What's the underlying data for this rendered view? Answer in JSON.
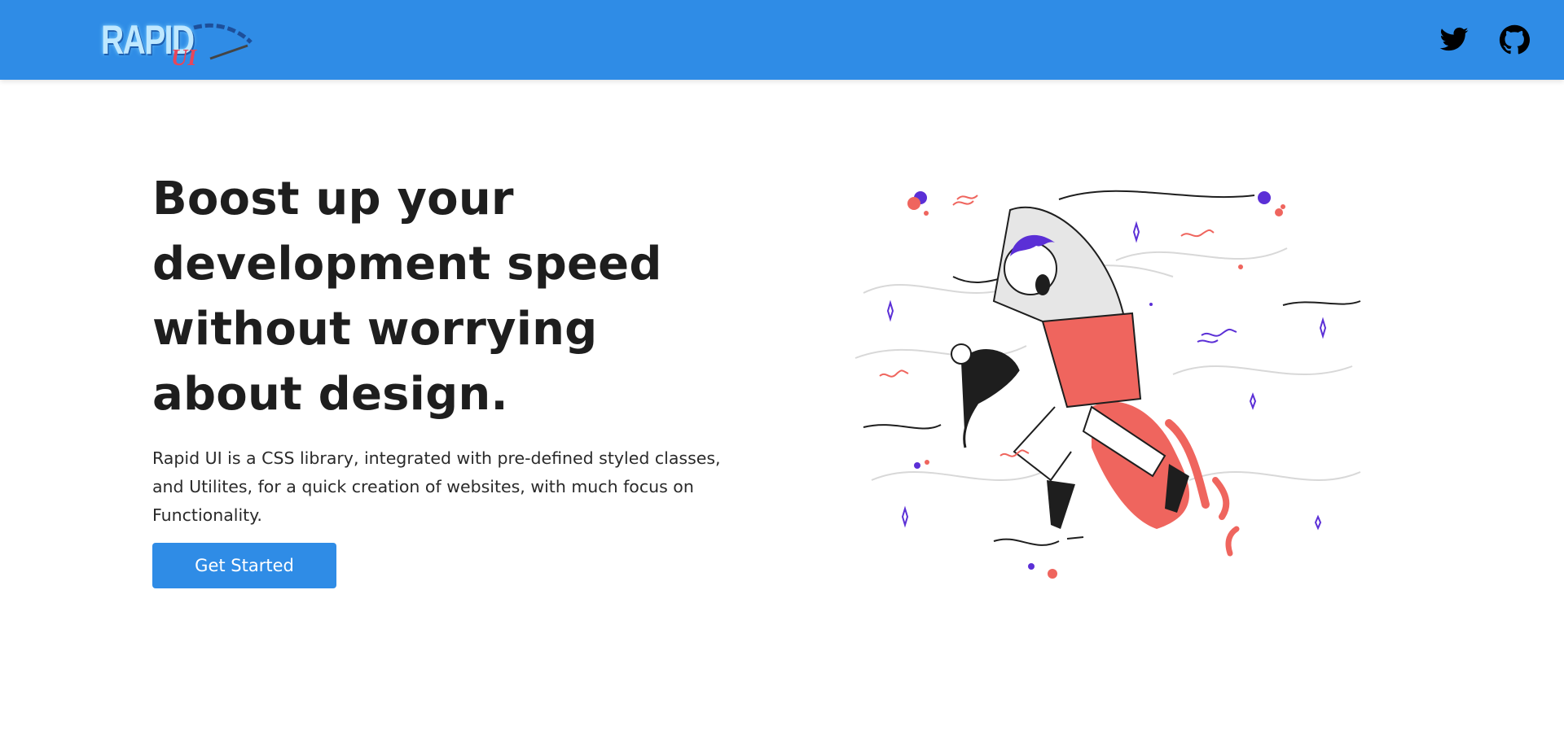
{
  "header": {
    "logo_text": "RAPID",
    "logo_sub": "UI",
    "icons": [
      "twitter-icon",
      "github-icon"
    ]
  },
  "hero": {
    "title": "Boost up your development speed without worrying about design.",
    "description": "Rapid UI is a CSS library, integrated with pre-defined styled classes, and Utilites, for a quick creation of websites, with much focus on Functionality.",
    "cta_label": "Get Started"
  },
  "colors": {
    "brand": "#2f8ce6",
    "accent_red": "#ef655e",
    "accent_purple": "#5b2fd6",
    "text": "#1e1e1e"
  }
}
